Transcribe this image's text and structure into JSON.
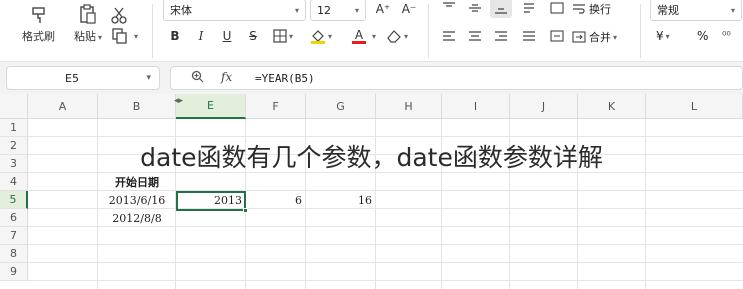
{
  "ribbon": {
    "format_painter": "格式刷",
    "paste": "粘贴",
    "font_name": "宋体",
    "font_size": "12",
    "wrap": "换行",
    "merge": "合并",
    "number_format": "常规",
    "currency_symbol": "¥",
    "percent_symbol": "%",
    "grow_font": "A⁺",
    "shrink_font": "A⁻",
    "bold": "B",
    "italic": "I",
    "underline": "U",
    "strike": "S",
    "font_color": "A"
  },
  "formula_bar": {
    "name_box": "E5",
    "fx_label": "fx",
    "formula": "=YEAR(B5)"
  },
  "columns": [
    "A",
    "B",
    "E",
    "F",
    "G",
    "H",
    "I",
    "J",
    "K",
    "L"
  ],
  "rows": [
    "1",
    "2",
    "3",
    "4",
    "5",
    "6",
    "7",
    "8",
    "9"
  ],
  "selected_cell": {
    "column": "E",
    "row": "5"
  },
  "cells": {
    "b4": "开始日期",
    "b5": "2013/6/16",
    "b6": "2012/8/8",
    "e5": "2013",
    "f5": "6",
    "g5": "16"
  },
  "overlay_title": "date函数有几个参数，date函数参数详解",
  "colors": {
    "accent": "#217346",
    "header_bg": "#f5f5f5",
    "selected_header_bg": "#e3eedb"
  }
}
